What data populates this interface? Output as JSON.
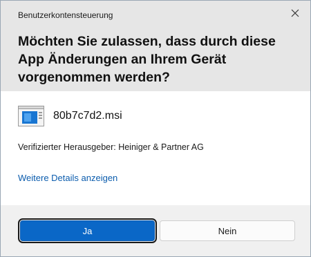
{
  "dialog": {
    "window_title": "Benutzerkontensteuerung",
    "heading": "Möchten Sie zulassen, dass durch diese App Änderungen an Ihrem Gerät vorgenommen werden?",
    "close_icon": "close-icon"
  },
  "file": {
    "icon": "msi-installer-icon",
    "name": "80b7c7d2.msi"
  },
  "publisher": {
    "text": "Verifizierter Herausgeber: Heiniger & Partner AG"
  },
  "details_link": {
    "label": "Weitere Details anzeigen"
  },
  "buttons": {
    "yes_label": "Ja",
    "no_label": "Nein"
  },
  "colors": {
    "header_bg": "#e6e6e6",
    "footer_bg": "#f0f0f0",
    "accent": "#0a67c7",
    "link": "#0b5cad"
  }
}
